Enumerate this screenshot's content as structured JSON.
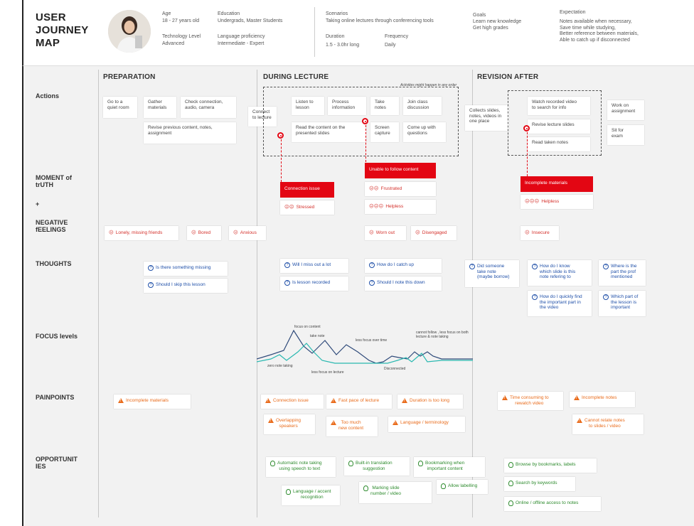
{
  "header": {
    "title_lines": [
      "USER",
      "JOURNEY",
      "MAP"
    ],
    "age_label": "Age",
    "age_value": "18 - 27 years old",
    "education_label": "Education",
    "education_value": "Undergrads, Master Students",
    "tech_label": "Technology Level",
    "tech_value": "Advanced",
    "lang_label": "Language proficiency",
    "lang_value": "Intermediate - Expert",
    "scenarios_label": "Scenarios",
    "scenarios_value": "Taking online lectures through conferencing tools",
    "duration_label": "Duration",
    "duration_value": "1.5 - 3.0hr long",
    "frequency_label": "Frequency",
    "frequency_value": "Daily",
    "goals_label": "Goals",
    "goals_value": "Learn new knowledge\nGet high grades",
    "expectation_label": "Expectation",
    "expectation_value": "Notes available when necessary,\nSave time while studying,\nBetter reference between materials,\nAble to catch up if disconnected"
  },
  "stages": [
    "PREPARATION",
    "DURING LECTURE",
    "REVISION AFTER"
  ],
  "rows": {
    "actions": "Actions",
    "moment": "MOMENT of\ntrUTH",
    "plus": "+",
    "negative": "NEGATIVE\nfEELINGS",
    "thoughts": "THOUGHTS",
    "focus": "FOCUS levels",
    "painpoints": "PAINPOINTS",
    "opportunities": "OPPORTUNIT\nIES"
  },
  "actions": {
    "prep": [
      "Go to a\nquiet room",
      "Gather\nmaterials",
      "Check connection,\naudio, camera",
      "Revise previous content, notes,\nassignment"
    ],
    "connect": "Connect\nto lecture",
    "activities_note": "Activities might happen in any order",
    "lecture": [
      "Listen to\nlesson",
      "Process\ninformation",
      "Take\nnotes",
      "Join class\ndiscussion",
      "Read the content on the\npresented slides",
      "Screen\ncapture",
      "Come up with\nquestions"
    ],
    "collects": "Collects slides,\nnotes, videos in\none place",
    "revision": [
      "Watch recorded video\nto search for info",
      "Revise lecture slides",
      "Read taken notes"
    ],
    "work": "Work on\nassignment",
    "sit": "Sit for\nexam"
  },
  "moments": [
    "Connection issue",
    "Unable to follow content",
    "Incomplete materials"
  ],
  "moment_feelings": [
    "Stressed",
    "Frustrated",
    "Helpless",
    "Helpless"
  ],
  "negative": [
    "Lonely, missing friends",
    "Bored",
    "Anxious",
    "Worn out",
    "Disengaged",
    "Insecure"
  ],
  "thoughts": [
    "Is there something missing",
    "Should I skip this lesson",
    "Will I miss out a lot",
    "Is lesson recorded",
    "How do I catch up",
    "Should I note this down",
    "Did someone\ntake note\n(maybe borrow)",
    "How do I know\nwhich slide is this\nnote refering to",
    "How do I quickly find\nthe important part in\nthe video",
    "Where is the\npart the prof\nmentioned",
    "Which part of\nthe lesson is\nimportant"
  ],
  "focus_notes": [
    "focus on content",
    "take note",
    "less focus over time",
    "cannot follow , less focus on both\nlecture & note taking",
    "zero note taking",
    "less focus on lecture",
    "Disconnected"
  ],
  "painpoints": [
    "Incomplete materials",
    "Connection issue",
    "Fast pace of lecture",
    "Duration is too long",
    "Overlapping\nspeakers",
    "Too much\nnew content",
    "Language / terminology",
    "Time consuming to\nrewatch video",
    "Incomplete notes",
    "Cannot relate notes\nto slides / video"
  ],
  "opportunities": [
    "Automatic note taking\nusing speech to text",
    "Built-in translation\nsuggestion",
    "Bookmarking when\nimportant content",
    "Language / accent\nrecognition",
    "Marking slide\nnumber / video",
    "Allow labelling",
    "Browse by bookmarks, labels",
    "Search by keywords",
    "Online / offline access to notes"
  ],
  "colors": {
    "accent_red": "#e30613",
    "thought_blue": "#1f4fa8",
    "pain_orange": "#e96c1c",
    "opp_green": "#2e8b2e",
    "focus_navy": "#2f4a7a",
    "focus_teal": "#29b8b0"
  }
}
